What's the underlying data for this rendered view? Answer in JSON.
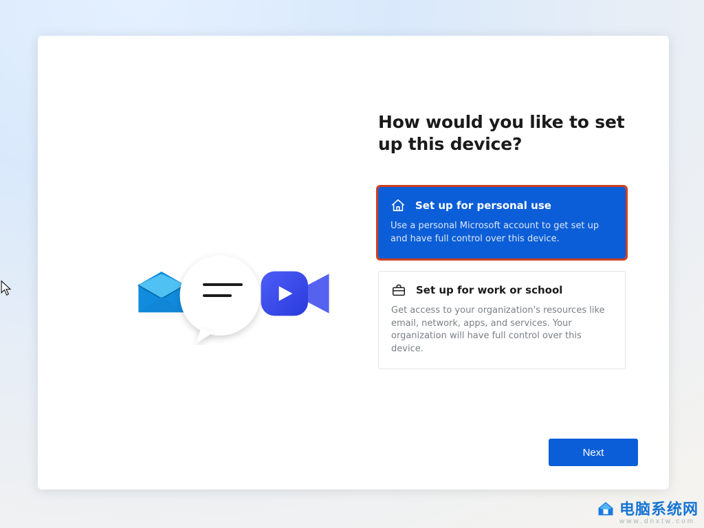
{
  "heading": "How would you like to set up this device?",
  "options": {
    "personal": {
      "label": "Set up for personal use",
      "desc": "Use a personal Microsoft account to get set up and have full control over this device.",
      "selected": true
    },
    "work": {
      "label": "Set up for work or school",
      "desc": "Get access to your organization's resources like email, network, apps, and services. Your organization will have full control over this device.",
      "selected": false
    }
  },
  "next_button": "Next",
  "watermark": {
    "main": "电脑系统网",
    "sub": "www.dnxtw.com"
  },
  "colors": {
    "accent": "#0b5ed7",
    "highlight_outline": "#d03f1e"
  }
}
